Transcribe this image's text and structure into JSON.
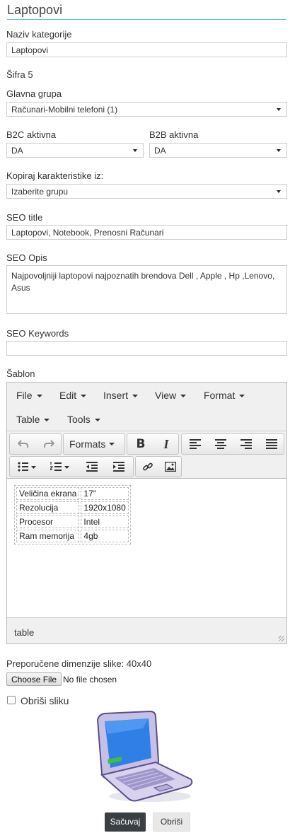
{
  "page": {
    "title": "Laptopovi"
  },
  "form": {
    "naziv_label": "Naziv kategorije",
    "naziv_value": "Laptopovi",
    "sifra_text": "Šifra 5",
    "glavna_label": "Glavna grupa",
    "glavna_value": "Računari-Mobilni telefoni (1)",
    "b2c_label": "B2C aktivna",
    "b2c_value": "DA",
    "b2b_label": "B2B aktivna",
    "b2b_value": "DA",
    "kopiraj_label": "Kopiraj karakteristike iz:",
    "kopiraj_value": "Izaberite grupu",
    "seo_title_label": "SEO title",
    "seo_title_value": "Laptopovi, Notebook, Prenosni Računari",
    "seo_opis_label": "SEO Opis",
    "seo_opis_value": "Najpovoljniji laptopovi najpoznatih brendova Dell , Apple , Hp ,Lenovo, Asus",
    "seo_keywords_label": "SEO Keywords",
    "seo_keywords_value": "",
    "sablon_label": "Šablon"
  },
  "editor": {
    "menu": [
      "File",
      "Edit",
      "Insert",
      "View",
      "Format",
      "Table",
      "Tools"
    ],
    "toolbar": {
      "formats_label": "Formats",
      "bold": "B",
      "italic": "I"
    },
    "icons": [
      "undo-icon",
      "redo-icon",
      "bold-icon",
      "italic-icon",
      "align-left-icon",
      "align-center-icon",
      "align-right-icon",
      "align-justify-icon",
      "bullet-list-icon",
      "numbered-list-icon",
      "outdent-icon",
      "indent-icon",
      "link-icon",
      "image-icon"
    ],
    "table_rows": [
      [
        "Veličina ekrana",
        "17\""
      ],
      [
        "Rezolucija",
        "1920x1080"
      ],
      [
        "Procesor",
        "Intel"
      ],
      [
        "Ram memorija",
        "4gb"
      ]
    ],
    "status_path": "table"
  },
  "image": {
    "dim_label": "Preporučene dimenzije slike: 40x40",
    "choose_file": "Choose File",
    "no_file": "No file chosen",
    "obrisi_sliku": "Obriši sliku",
    "preview_icon": "laptop-icon"
  },
  "actions": {
    "save": "Sačuvaj",
    "delete": "Obriši"
  }
}
